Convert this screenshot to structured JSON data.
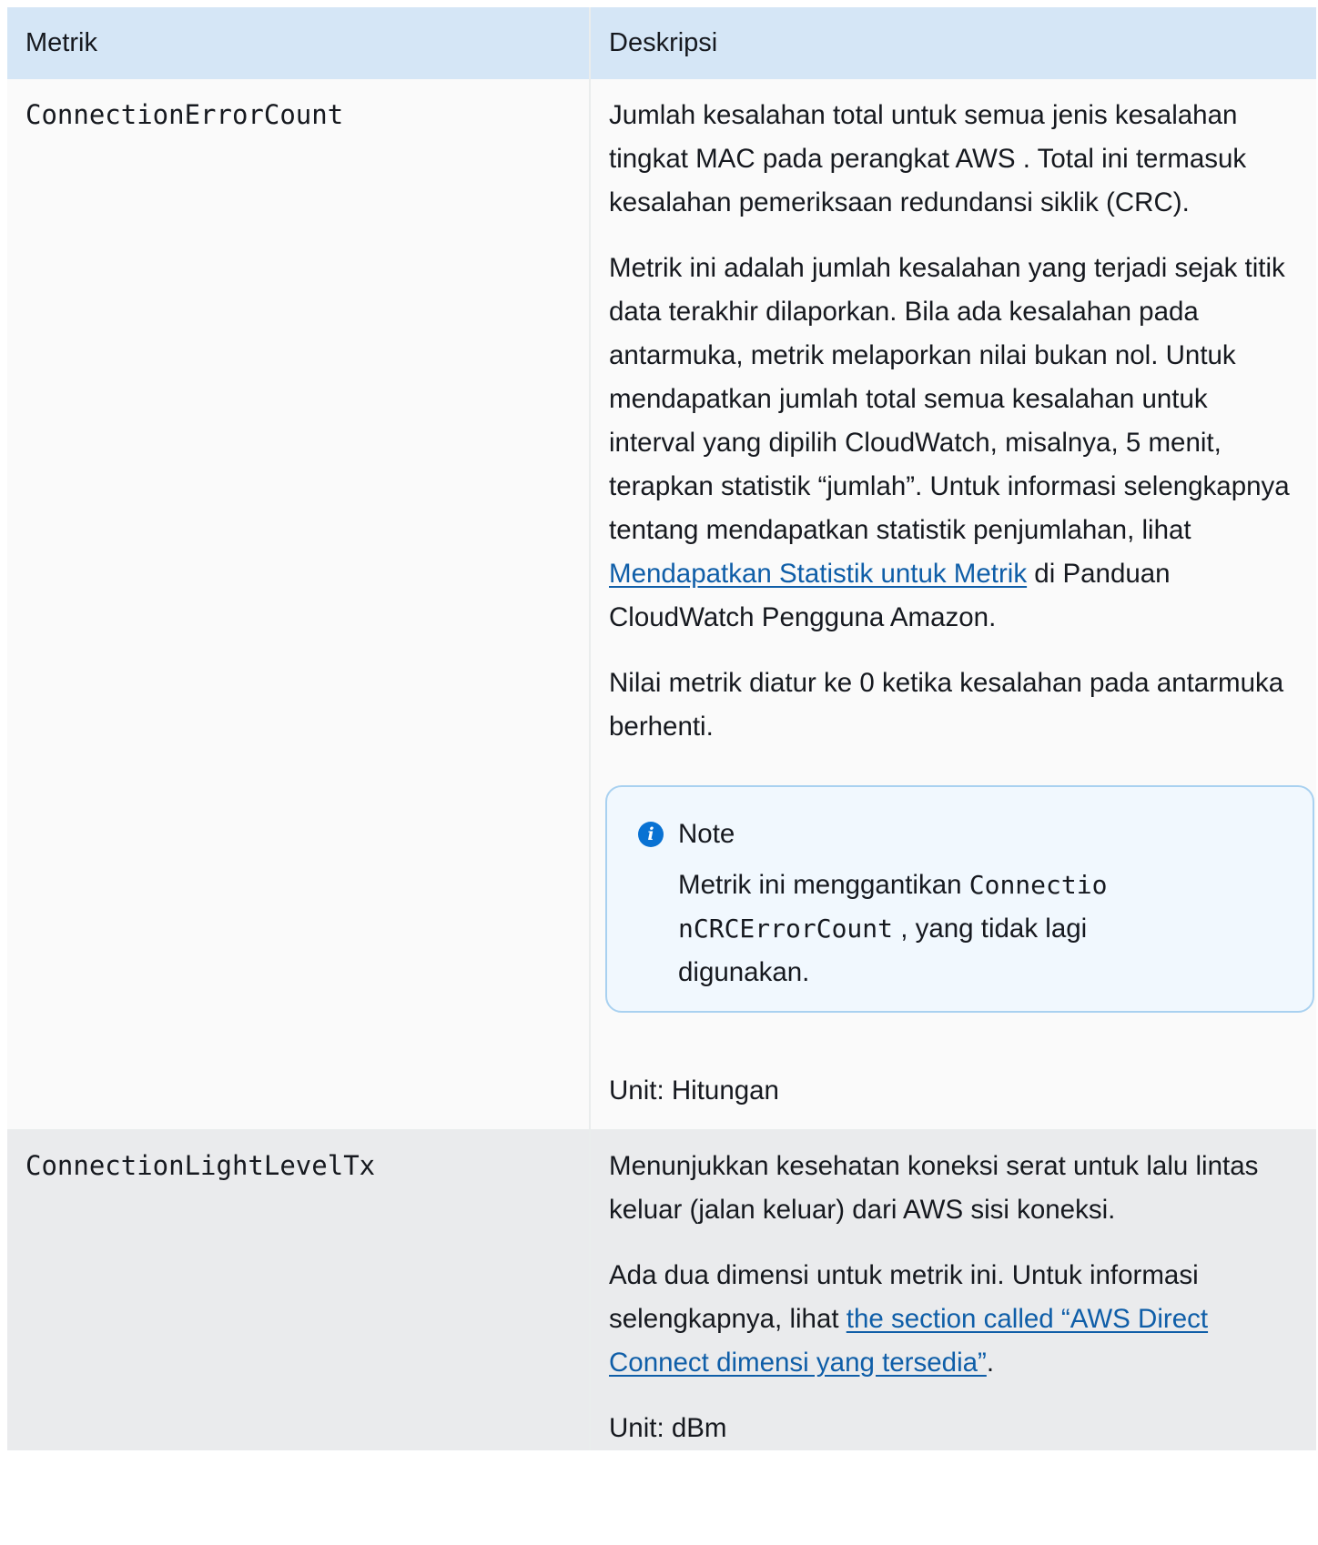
{
  "table": {
    "headers": [
      "Metrik",
      "Deskripsi"
    ],
    "rows": [
      {
        "metric": "ConnectionErrorCount",
        "desc_p1": "Jumlah kesalahan total untuk semua jenis kesalahan tingkat MAC pada perangkat AWS . Total ini termasuk kesalahan pemeriksaan redundansi siklik (CRC).",
        "desc_p2_before": "Metrik ini adalah jumlah kesalahan yang terjadi sejak titik data terakhir dilaporkan. Bila ada kesalahan pada antarmuka, metrik melaporkan nilai bukan nol. Untuk mendapatkan jumlah total semua kesalahan untuk interval yang dipilih CloudWatch, misalnya, 5 menit, terapkan statistik “jumlah”. Untuk informasi selengkapnya tentang mendapatkan statistik penjumlahan, lihat ",
        "desc_p2_link": "Mendapatkan Statistik untuk Metrik",
        "desc_p2_after": " di Panduan CloudWatch Pengguna Amazon.",
        "desc_p3": "Nilai metrik diatur ke 0 ketika kesalahan pada antarmuka berhenti.",
        "note": {
          "icon": "info-icon",
          "title": "Note",
          "text_before": "Metrik ini menggantikan ",
          "code": "ConnectionCRCErrorCount",
          "text_after": " , yang tidak lagi digunakan."
        },
        "unit": "Unit: Hitungan"
      },
      {
        "metric": "ConnectionLightLevelTx",
        "desc_p1": "Menunjukkan kesehatan koneksi serat untuk lalu lintas keluar (jalan keluar) dari AWS sisi koneksi.",
        "desc_p2_before": "Ada dua dimensi untuk metrik ini. Untuk informasi selengkapnya, lihat ",
        "desc_p2_link": "the section called “AWS Direct Connect dimensi yang tersedia”",
        "desc_p2_after": ".",
        "unit": "Unit: dBm"
      }
    ]
  },
  "colors": {
    "header_bg": "#d5e6f6",
    "link": "#0f5ea8",
    "note_border": "#a9d1f0",
    "note_bg": "#f1f8fe",
    "info_icon": "#0972d3"
  }
}
